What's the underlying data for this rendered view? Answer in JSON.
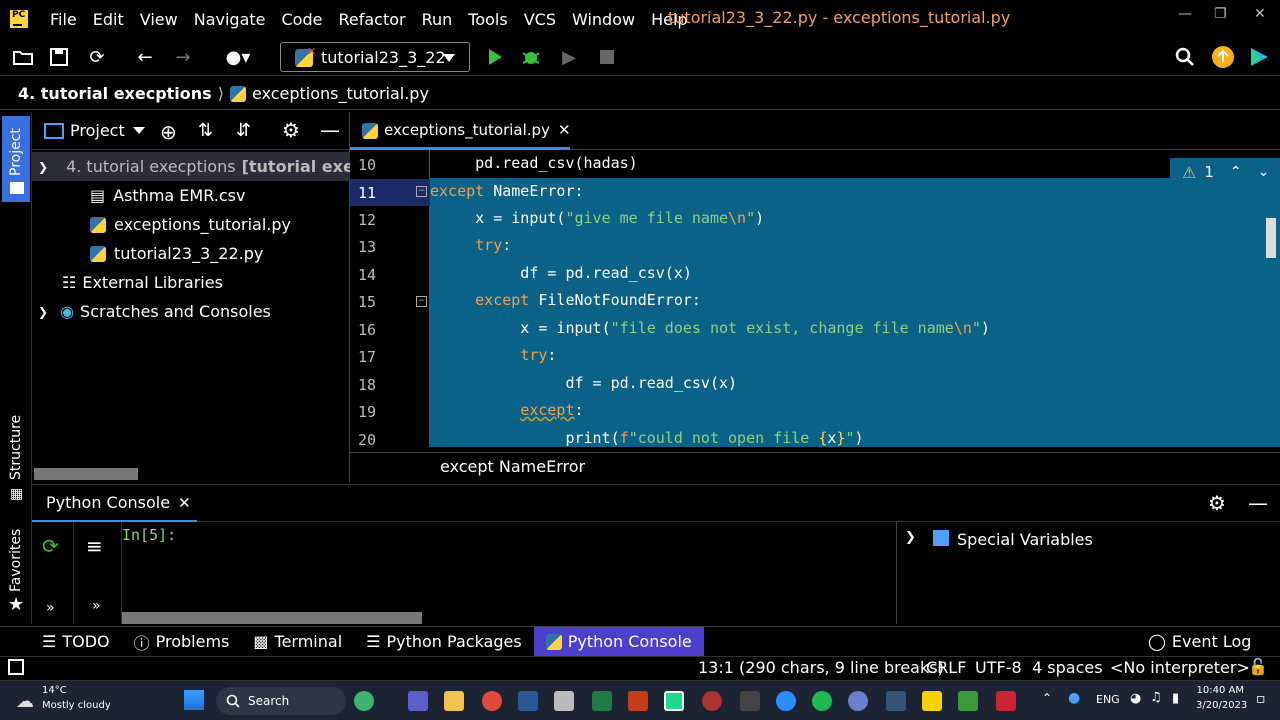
{
  "menubar": {
    "items": [
      "File",
      "Edit",
      "View",
      "Navigate",
      "Code",
      "Refactor",
      "Run",
      "Tools",
      "VCS",
      "Window",
      "Help"
    ],
    "title": "tutorial23_3_22.py - exceptions_tutorial.py"
  },
  "toolbar": {
    "run_config": "tutorial23_3_22"
  },
  "breadcrumb": {
    "project": "4. tutorial execptions",
    "file": "exceptions_tutorial.py"
  },
  "sidebar_left": {
    "project": "Project",
    "structure": "Structure",
    "favorites": "Favorites"
  },
  "project_panel": {
    "title": "Project",
    "root_name": "4. tutorial execptions",
    "root_suffix": "[tutorial exec",
    "files": [
      "Asthma EMR.csv",
      "exceptions_tutorial.py",
      "tutorial23_3_22.py"
    ],
    "external": "External Libraries",
    "scratches": "Scratches and Consoles"
  },
  "editor": {
    "tab": "exceptions_tutorial.py",
    "line_numbers": [
      "10",
      "11",
      "12",
      "13",
      "14",
      "15",
      "16",
      "17",
      "18",
      "19",
      "20"
    ],
    "current_line": "11",
    "warnings": "1",
    "hint": "except NameError"
  },
  "console": {
    "tab": "Python Console",
    "prompt": "In[5]:",
    "special_variables": "Special Variables"
  },
  "bottom_tabs": [
    "TODO",
    "Problems",
    "Terminal",
    "Python Packages",
    "Python Console"
  ],
  "event_log": "Event Log",
  "status": {
    "position": "13:1 (290 chars, 9 line breaks)",
    "line_sep": "CRLF",
    "encoding": "UTF-8",
    "indent": "4 spaces",
    "interpreter": "<No interpreter>"
  },
  "taskbar": {
    "temp": "14°C",
    "weather": "Mostly cloudy",
    "search": "Search",
    "lang": "ENG",
    "time": "10:40 AM",
    "date": "3/20/2023"
  }
}
